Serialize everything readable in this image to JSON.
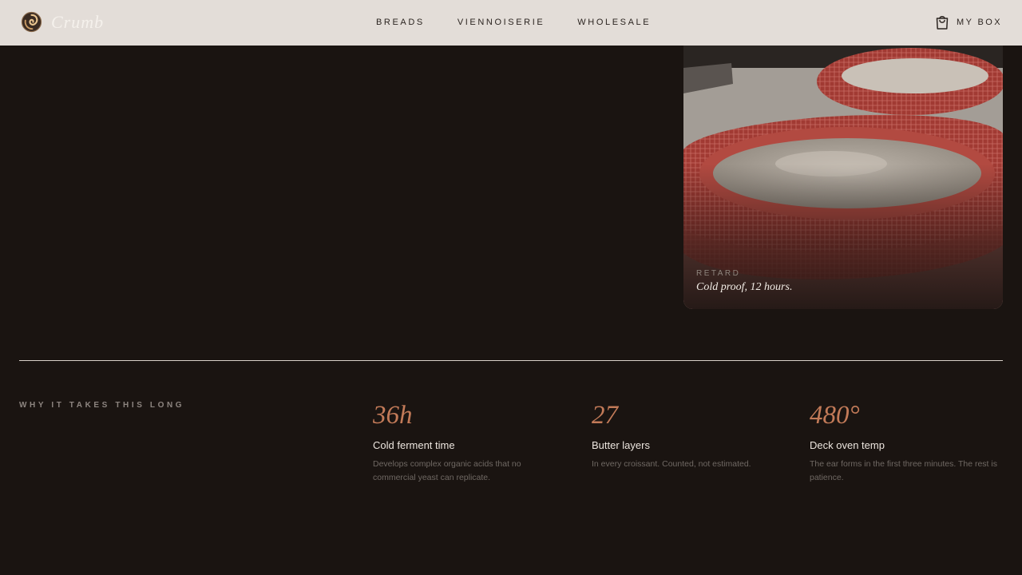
{
  "brand": {
    "name": "Crumb",
    "logo_icon": "swirl-logo-icon"
  },
  "nav": {
    "links": [
      {
        "label": "BREADS"
      },
      {
        "label": "VIENNOISERIE"
      },
      {
        "label": "WHOLESALE"
      }
    ],
    "cart": {
      "icon": "shopping-bag-icon",
      "label": "MY BOX"
    }
  },
  "feature_image": {
    "tag": "RETARD",
    "caption": "Cold proof, 12 hours."
  },
  "why_section": {
    "eyebrow": "WHY IT TAKES THIS LONG",
    "stats": [
      {
        "value": "36h",
        "label": "Cold ferment time",
        "description": "Develops complex organic acids that no commercial yeast can replicate."
      },
      {
        "value": "27",
        "label": "Butter layers",
        "description": "In every croissant. Counted, not estimated."
      },
      {
        "value": "480°",
        "label": "Deck oven temp",
        "description": "The ear forms in the first three minutes. The rest is patience."
      }
    ]
  },
  "colors": {
    "background": "#1a1411",
    "nav_bg": "#e3ddd8",
    "accent": "#c27a58",
    "divider": "#d9d1c9"
  }
}
